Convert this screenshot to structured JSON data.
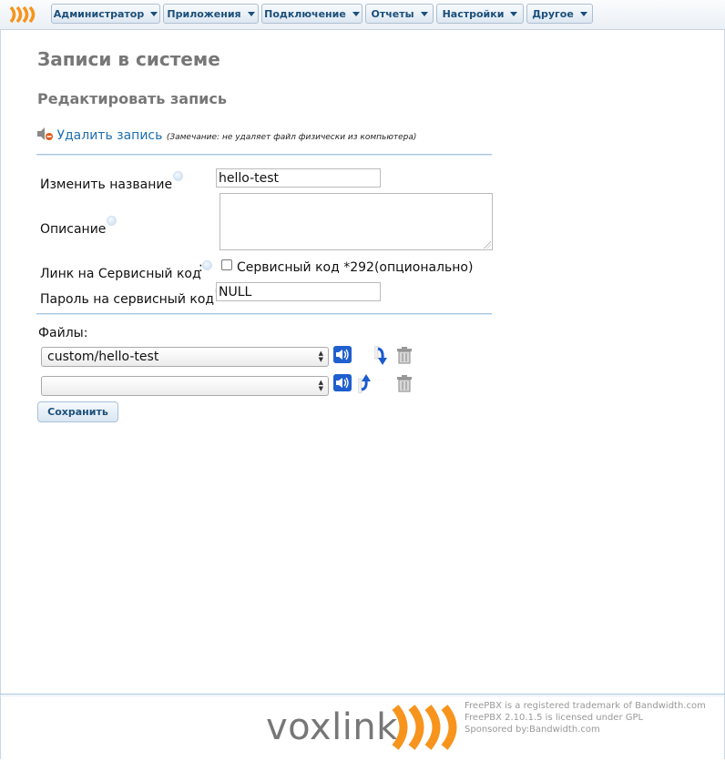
{
  "menu": [
    "Администратор",
    "Приложения",
    "Подключение",
    "Отчеты",
    "Настройки",
    "Другое"
  ],
  "page": {
    "title": "Записи в системе",
    "subtitle": "Редактировать запись"
  },
  "delete": {
    "link": "Удалить запись",
    "note": "(Замечание: не удаляет файл физически из компьютера)"
  },
  "form": {
    "name_label": "Изменить название",
    "name_value": "hello-test",
    "description_label": "Описание",
    "description_value": "",
    "service_link_label": "Линк на Сервисный код",
    "service_link_colon": ":",
    "service_checkbox_label": "Сервисный код *292(опционально)",
    "password_label": "Пароль на сервисный код",
    "password_value": "NULL"
  },
  "files": {
    "label": "Файлы:",
    "rows": [
      {
        "value": "custom/hello-test"
      },
      {
        "value": ""
      }
    ]
  },
  "save_label": "Сохранить",
  "footer": {
    "brand": "voxlink",
    "lines": [
      "FreePBX is a registered trademark of Bandwidth.com",
      "FreePBX 2.10.1.5 is licensed under GPL",
      "Sponsored by:Bandwidth.com"
    ]
  },
  "colors": {
    "accent_orange": "#f7941d",
    "link_blue": "#1e6fb0",
    "menu_text": "#1b4f7a"
  }
}
